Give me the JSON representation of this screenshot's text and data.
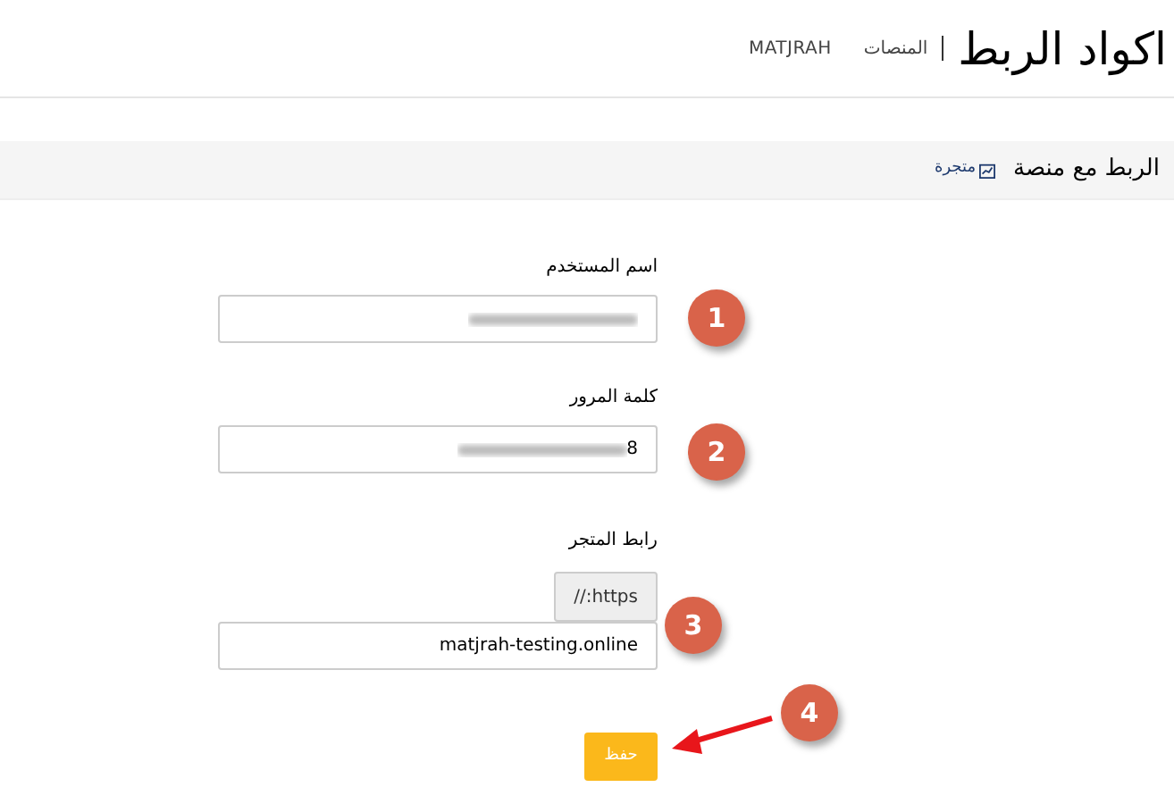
{
  "header": {
    "title": "اكواد الربط",
    "breadcrumb": [
      "المنصات",
      "MATJRAH"
    ]
  },
  "section": {
    "title": "الربط مع منصة",
    "link": "متجرة"
  },
  "form": {
    "fields": [
      {
        "label": "اسم المستخدم",
        "blurred": true
      },
      {
        "label": "كلمة المرور",
        "blurred": true,
        "value": "8"
      },
      {
        "label": "رابط المتجر",
        "blurred": false,
        "prefix": "https://",
        "value": "matjrah-testing.online"
      }
    ],
    "save_button": "حفظ"
  },
  "annotations": [
    "1",
    "2",
    "3",
    "4"
  ]
}
